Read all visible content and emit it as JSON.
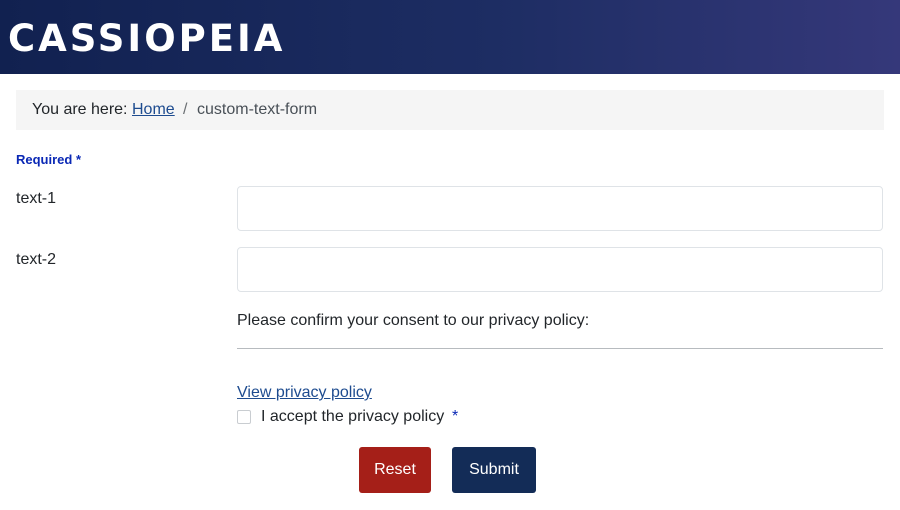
{
  "header": {
    "logo_text": "CASSIOPEIA",
    "colors": {
      "gradient_start": "#112150",
      "gradient_end": "#35387a"
    }
  },
  "breadcrumb": {
    "prefix": "You are here:",
    "home_label": "Home",
    "separator": "/",
    "current": "custom-text-form"
  },
  "form": {
    "required_label": "Required",
    "required_marker": "*",
    "fields": [
      {
        "label": "text-1",
        "value": "",
        "placeholder": ""
      },
      {
        "label": "text-2",
        "value": "",
        "placeholder": ""
      }
    ],
    "consent_text": "Please confirm your consent to our privacy policy:",
    "privacy_link": "View privacy policy",
    "checkbox": {
      "label": "I accept the privacy policy",
      "required_marker": "*",
      "checked": false
    },
    "buttons": {
      "reset_label": "Reset",
      "submit_label": "Submit",
      "reset_color": "#a51f18",
      "submit_color": "#132c57"
    }
  }
}
